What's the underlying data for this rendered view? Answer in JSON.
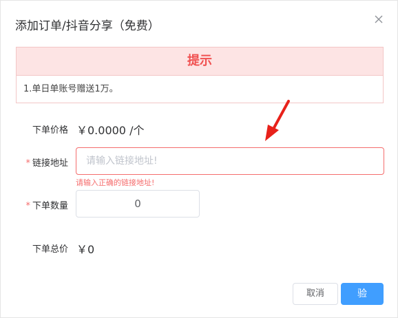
{
  "dialog": {
    "title": "添加订单/抖音分享（免费）"
  },
  "alert": {
    "heading": "提示",
    "message": "1.单日单账号赠送1万。"
  },
  "form": {
    "price": {
      "label": "下单价格",
      "value": "￥0.0000 /个"
    },
    "url": {
      "required_mark": "*",
      "label": "链接地址",
      "value": "",
      "placeholder": "请输入链接地址!",
      "error": "请输入正确的链接地址!"
    },
    "quantity": {
      "required_mark": "*",
      "label": "下单数量",
      "value": "0"
    },
    "total": {
      "label": "下单总价",
      "value": "￥0"
    }
  },
  "footer": {
    "cancel_label": "取消",
    "confirm_label": "验"
  },
  "colors": {
    "primary": "#409eff",
    "danger": "#f56c6c",
    "alert_title": "#f05050",
    "alert_bg": "#fde4e4",
    "annotation_arrow": "#e8211a"
  },
  "icons": {
    "close": "close-icon",
    "arrow": "red-arrow-icon"
  }
}
